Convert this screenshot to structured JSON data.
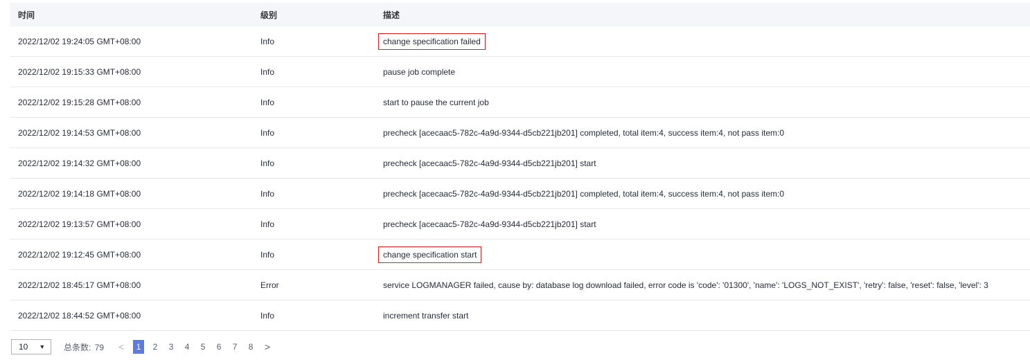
{
  "header": {
    "time": "时间",
    "level": "级别",
    "desc": "描述"
  },
  "rows": [
    {
      "time": "2022/12/02 19:24:05 GMT+08:00",
      "level": "Info",
      "desc": "change specification failed"
    },
    {
      "time": "2022/12/02 19:15:33 GMT+08:00",
      "level": "Info",
      "desc": "pause job complete"
    },
    {
      "time": "2022/12/02 19:15:28 GMT+08:00",
      "level": "Info",
      "desc": "start to pause the current job"
    },
    {
      "time": "2022/12/02 19:14:53 GMT+08:00",
      "level": "Info",
      "desc": "precheck [acecaac5-782c-4a9d-9344-d5cb221jb201] completed, total item:4, success item:4, not pass item:0"
    },
    {
      "time": "2022/12/02 19:14:32 GMT+08:00",
      "level": "Info",
      "desc": "precheck [acecaac5-782c-4a9d-9344-d5cb221jb201] start"
    },
    {
      "time": "2022/12/02 19:14:18 GMT+08:00",
      "level": "Info",
      "desc": "precheck [acecaac5-782c-4a9d-9344-d5cb221jb201] completed, total item:4, success item:4, not pass item:0"
    },
    {
      "time": "2022/12/02 19:13:57 GMT+08:00",
      "level": "Info",
      "desc": "precheck [acecaac5-782c-4a9d-9344-d5cb221jb201] start"
    },
    {
      "time": "2022/12/02 19:12:45 GMT+08:00",
      "level": "Info",
      "desc": "change specification start"
    },
    {
      "time": "2022/12/02 18:45:17 GMT+08:00",
      "level": "Error",
      "desc": "service LOGMANAGER failed, cause by: database log download failed, error code is 'code': '01300', 'name': 'LOGS_NOT_EXIST', 'retry': false, 'reset': false, 'level': 3"
    },
    {
      "time": "2022/12/02 18:44:52 GMT+08:00",
      "level": "Info",
      "desc": "increment transfer start"
    }
  ],
  "pagination": {
    "page_size": "10",
    "total_label": "总条数:",
    "total": "79",
    "prev": "<",
    "next": ">",
    "pages": [
      "1",
      "2",
      "3",
      "4",
      "5",
      "6",
      "7",
      "8"
    ],
    "current": "1"
  },
  "colors": {
    "highlight_box": "#e02020",
    "active_page": "#5e7ce0",
    "header_bg": "#f4f6fa"
  }
}
